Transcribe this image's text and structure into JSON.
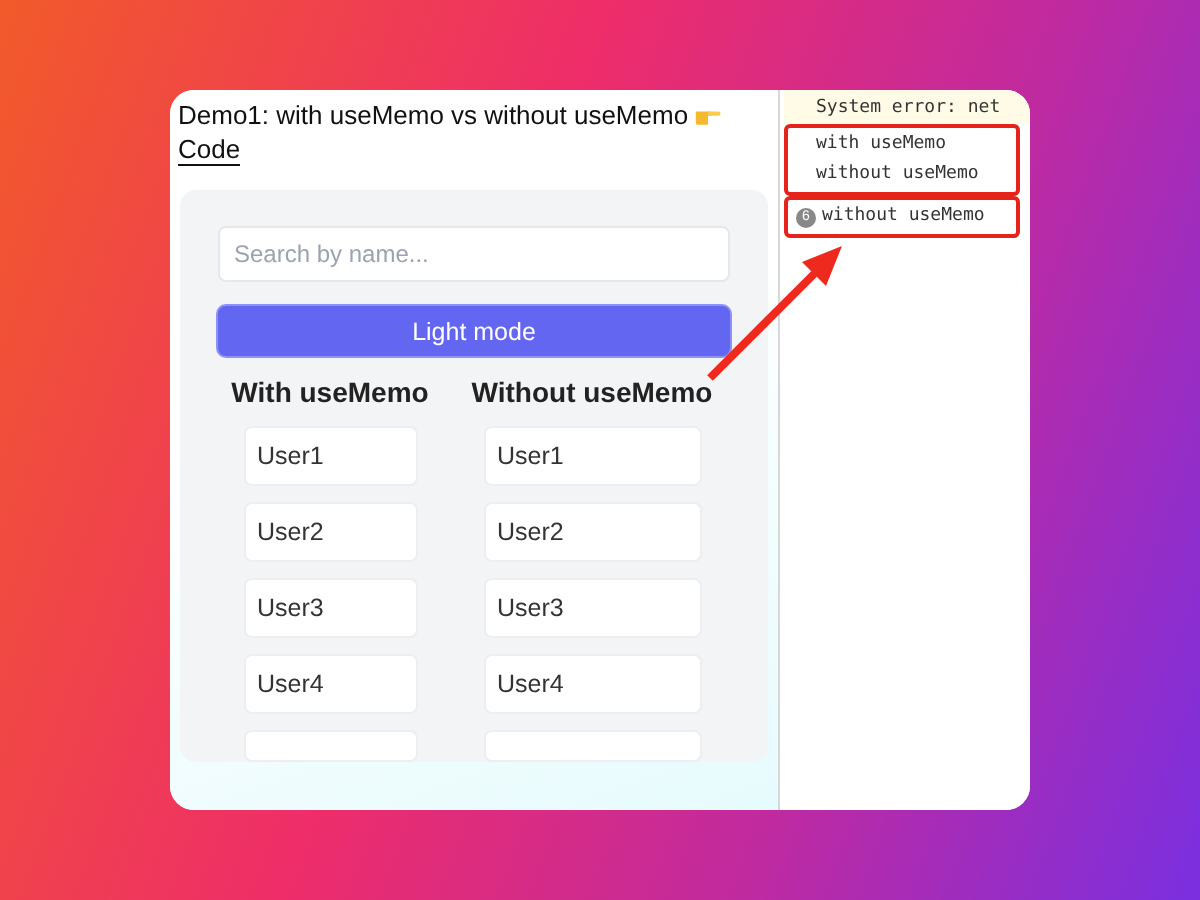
{
  "header": {
    "title": "Demo1: with useMemo vs without useMemo",
    "link": "Code"
  },
  "search": {
    "placeholder": "Search by name..."
  },
  "theme_button": "Light mode",
  "columns": [
    {
      "heading": "With useMemo",
      "items": [
        "User1",
        "User2",
        "User3",
        "User4"
      ]
    },
    {
      "heading": "Without useMemo",
      "items": [
        "User1",
        "User2",
        "User3",
        "User4"
      ]
    }
  ],
  "console": {
    "groups": [
      {
        "highlighted": false,
        "lines": [
          {
            "text": "System error: net"
          }
        ]
      },
      {
        "highlighted": true,
        "lines": [
          {
            "text": "with useMemo"
          },
          {
            "text": "without useMemo"
          }
        ]
      },
      {
        "highlighted": true,
        "lines": [
          {
            "text": "without useMemo",
            "count": "6"
          }
        ]
      }
    ]
  }
}
